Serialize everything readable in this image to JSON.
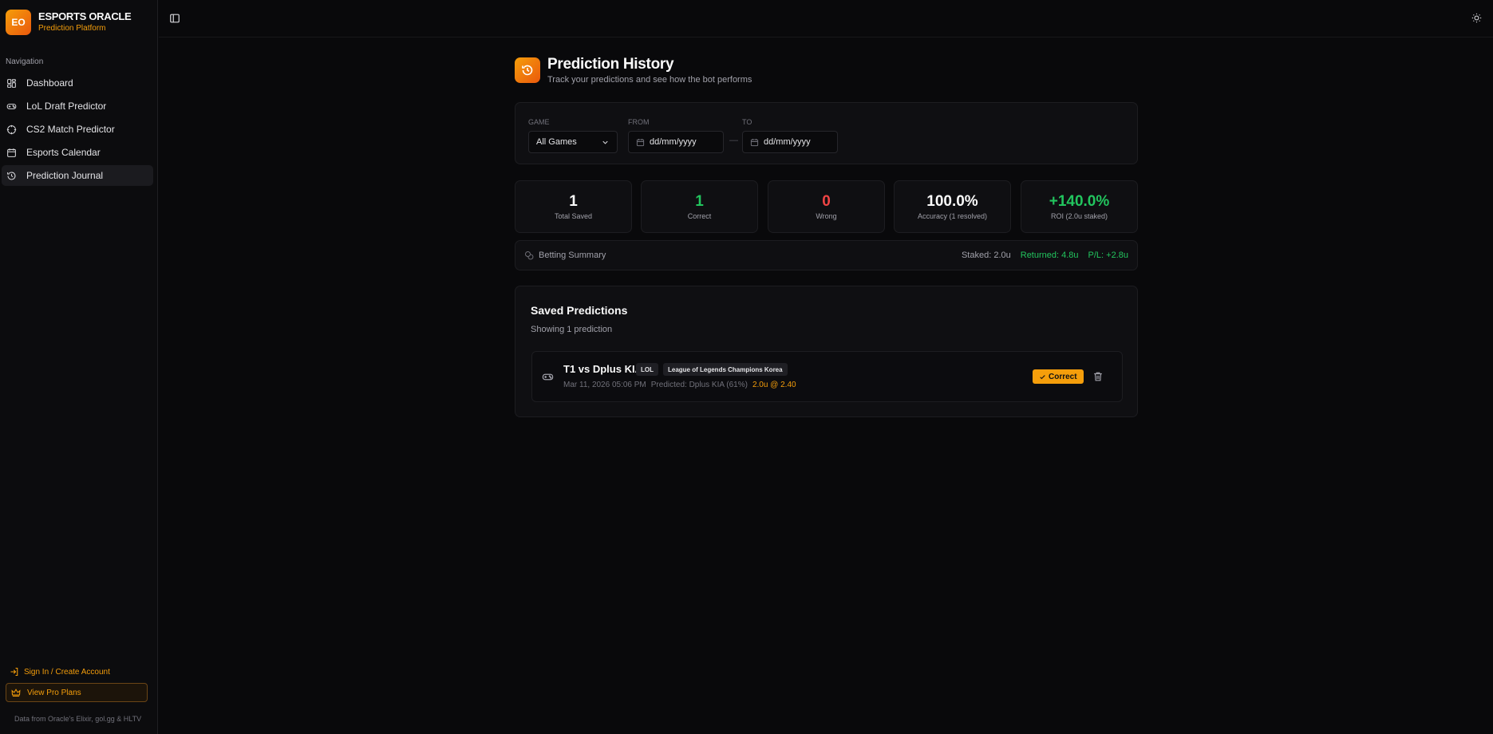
{
  "brand": {
    "logo": "EO",
    "name": "ESPORTS ORACLE",
    "subtitle": "Prediction Platform"
  },
  "nav": {
    "heading": "Navigation",
    "items": [
      {
        "label": "Dashboard",
        "icon": "dashboard-icon"
      },
      {
        "label": "LoL Draft Predictor",
        "icon": "gamepad-icon"
      },
      {
        "label": "CS2 Match Predictor",
        "icon": "crosshair-icon"
      },
      {
        "label": "Esports Calendar",
        "icon": "calendar-icon"
      },
      {
        "label": "Prediction Journal",
        "icon": "history-icon",
        "active": true
      }
    ]
  },
  "sidebar_footer": {
    "signin": "Sign In / Create Account",
    "pro": "View Pro Plans",
    "note": "Data from Oracle's Elixir, gol.gg & HLTV"
  },
  "page": {
    "title": "Prediction History",
    "subtitle": "Track your predictions and see how the bot performs"
  },
  "filters": {
    "game_label": "GAME",
    "game_value": "All Games",
    "from_label": "FROM",
    "from_placeholder": "dd/mm/yyyy",
    "to_label": "TO",
    "to_placeholder": "dd/mm/yyyy",
    "separator": "—"
  },
  "stats": [
    {
      "value": "1",
      "label": "Total Saved",
      "color": "#fafafa"
    },
    {
      "value": "1",
      "label": "Correct",
      "color": "#22c55e"
    },
    {
      "value": "0",
      "label": "Wrong",
      "color": "#ef4444"
    },
    {
      "value": "100.0%",
      "label": "Accuracy (1 resolved)",
      "color": "#fafafa"
    },
    {
      "value": "+140.0%",
      "label": "ROI (2.0u staked)",
      "color": "#22c55e"
    }
  ],
  "summary": {
    "title": "Betting Summary",
    "staked": "Staked: 2.0u",
    "returned": "Returned: 4.8u",
    "pl": "P/L: +2.8u"
  },
  "saved": {
    "title": "Saved Predictions",
    "count": "Showing 1 prediction",
    "items": [
      {
        "match": "T1 vs Dplus KIA",
        "game_tag": "LOL",
        "league_tag": "League of Legends Champions Korea",
        "date": "Mar 11, 2026 05:06 PM",
        "pick": "Predicted: Dplus KIA (61%)",
        "stake": "2.0u @ 2.40",
        "status": "Correct"
      }
    ]
  },
  "colors": {
    "accent": "#f59e0b",
    "positive": "#22c55e",
    "negative": "#ef4444",
    "background": "#09090b"
  }
}
